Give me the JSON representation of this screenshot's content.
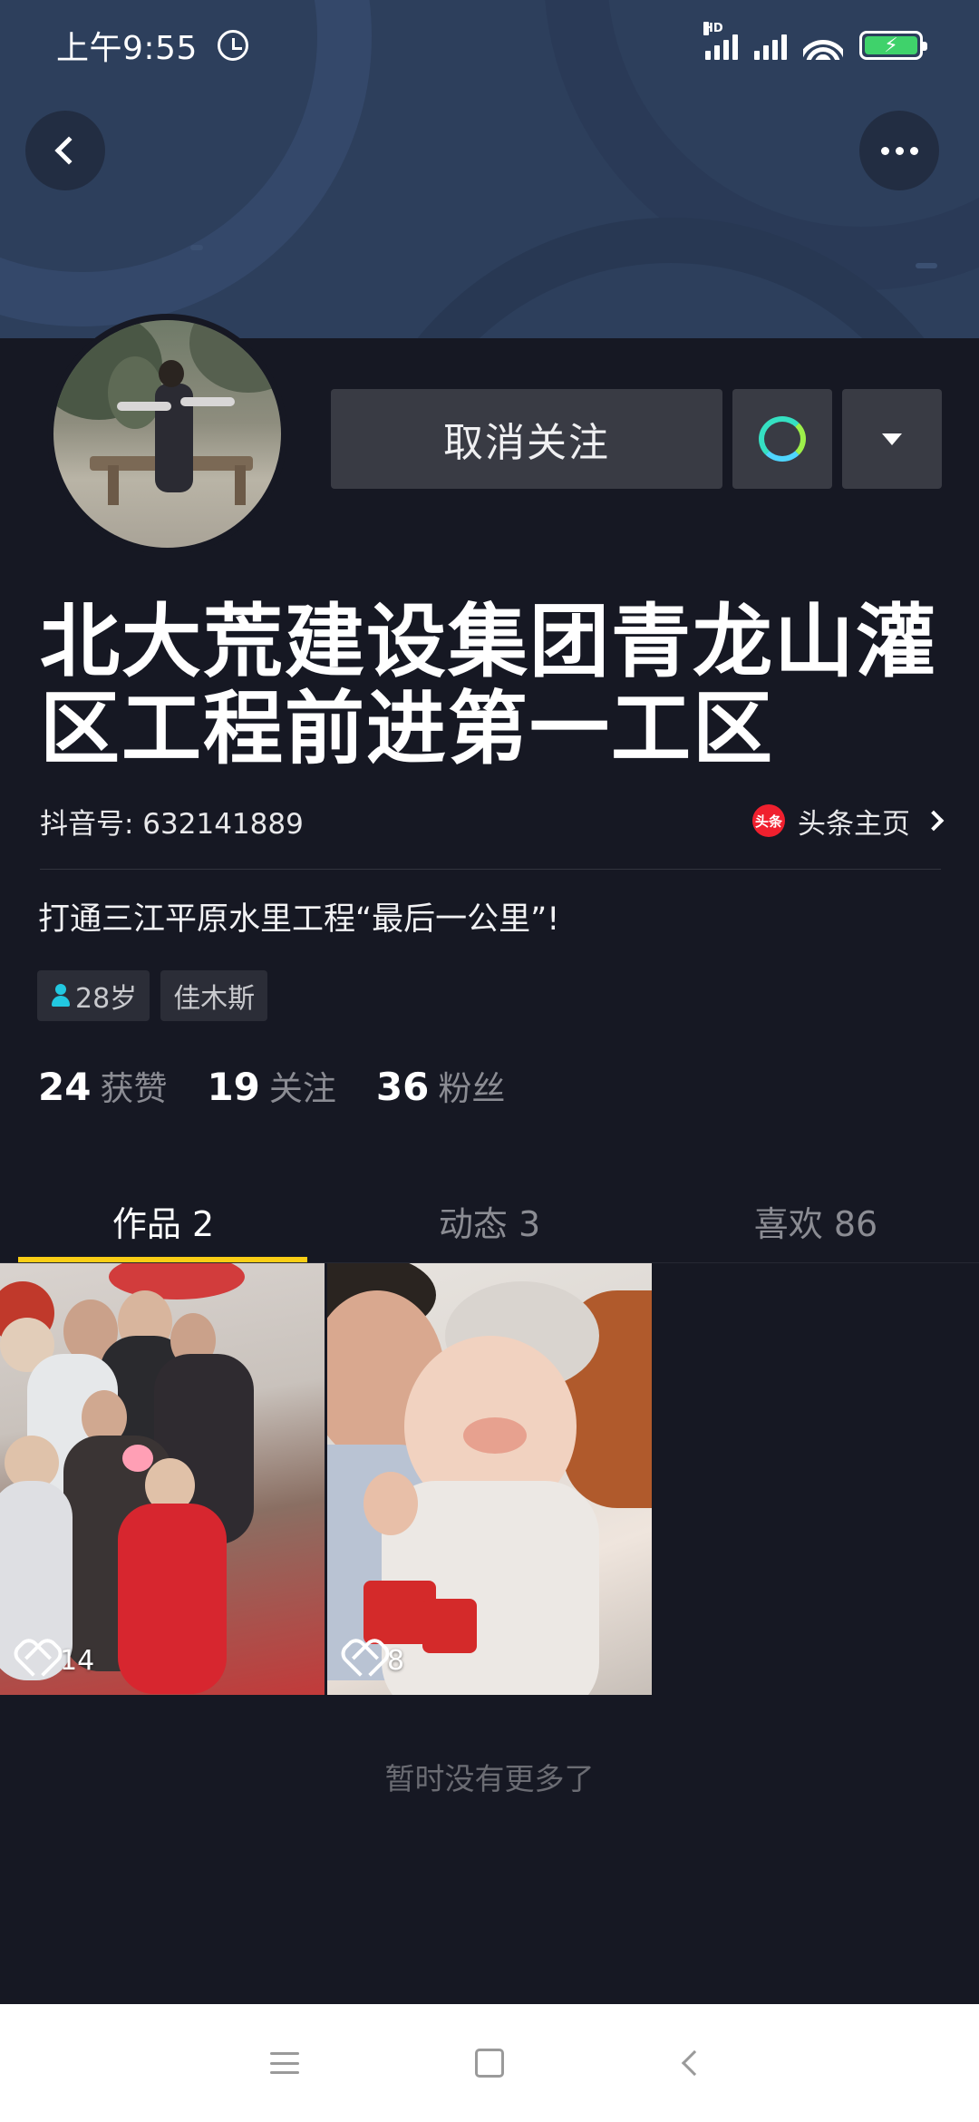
{
  "status_bar": {
    "time": "上午9:55",
    "icons": [
      "alarm-icon",
      "hd-signal-icon",
      "signal-icon",
      "wifi-icon",
      "battery-charging-icon"
    ],
    "hd_label": "HD"
  },
  "top_actions": {
    "back_icon": "chevron-left-icon",
    "more_icon": "more-dots-icon"
  },
  "profile": {
    "unfollow_label": "取消关注",
    "message_icon": "chat-bubble-icon",
    "dropdown_icon": "triangle-down-icon",
    "nickname": "北大荒建设集团青龙山灌区工程前进第一工区",
    "douyin_id": "抖音号: 632141889",
    "toutiao_logo_text": "头条",
    "toutiao_label": "头条主页",
    "signature": "打通三江平原水里工程“最后一公里”!",
    "tags": {
      "age": "28岁",
      "location": "佳木斯"
    },
    "stats": [
      {
        "num": "24",
        "label": "获赞"
      },
      {
        "num": "19",
        "label": "关注"
      },
      {
        "num": "36",
        "label": "粉丝"
      }
    ]
  },
  "tabs": [
    {
      "label": "作品 2",
      "active": true
    },
    {
      "label": "动态 3",
      "active": false
    },
    {
      "label": "喜欢 86",
      "active": false
    }
  ],
  "videos": [
    {
      "likes": "14"
    },
    {
      "likes": "8"
    }
  ],
  "empty_hint": "暂时没有更多了",
  "colors": {
    "background": "#161823",
    "tab_indicator": "#face15",
    "button_bg": "#393b44",
    "secondary_text": "#8b8c93"
  }
}
